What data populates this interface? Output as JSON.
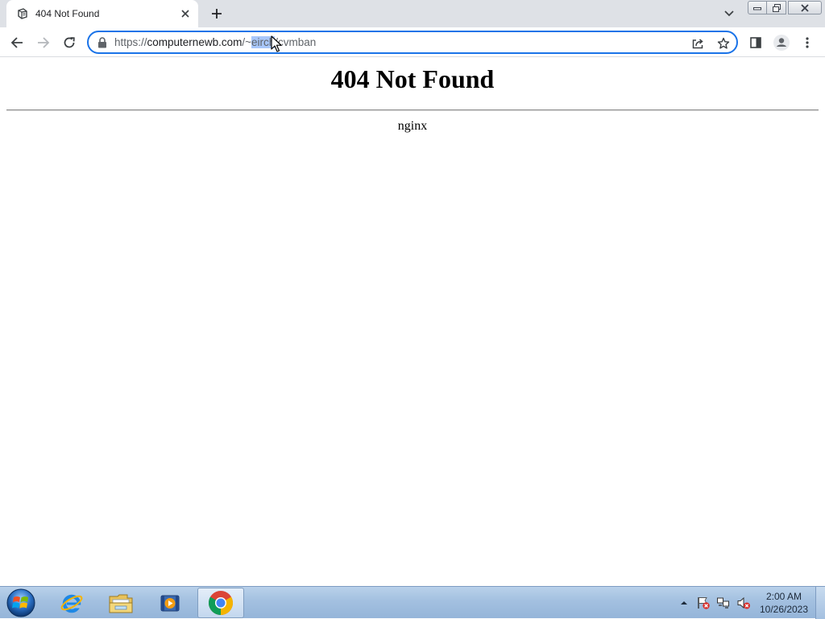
{
  "browser": {
    "tab": {
      "title": "404 Not Found",
      "favicon": "page-favicon",
      "close_icon": "close-icon"
    },
    "new_tab_icon": "plus-icon",
    "tab_search_icon": "chevron-down-icon",
    "window_controls": [
      "minimize",
      "restore",
      "close"
    ],
    "toolbar": {
      "back_icon": "back-arrow-icon",
      "forward_icon": "forward-arrow-icon",
      "reload_icon": "reload-icon",
      "url": {
        "host_prefix": "https://",
        "host": "computernewb.com",
        "path_before_selection": "/~",
        "selection": "eirch",
        "path_after_selection": "/cvmban"
      },
      "share_icon": "share-icon",
      "bookmark_icon": "star-icon",
      "side_panel_icon": "side-panel-icon",
      "profile_icon": "profile-icon",
      "menu_icon": "kebab-menu-icon"
    }
  },
  "page": {
    "heading": "404 Not Found",
    "server": "nginx"
  },
  "taskbar": {
    "items": [
      "start-orb",
      "internet-explorer",
      "windows-explorer",
      "media-player",
      "google-chrome"
    ],
    "active": "google-chrome",
    "tray": [
      "show-hidden-icons",
      "action-center-flag",
      "network",
      "volume-muted"
    ],
    "clock": {
      "time": "2:00 AM",
      "date": "10/26/2023"
    }
  }
}
